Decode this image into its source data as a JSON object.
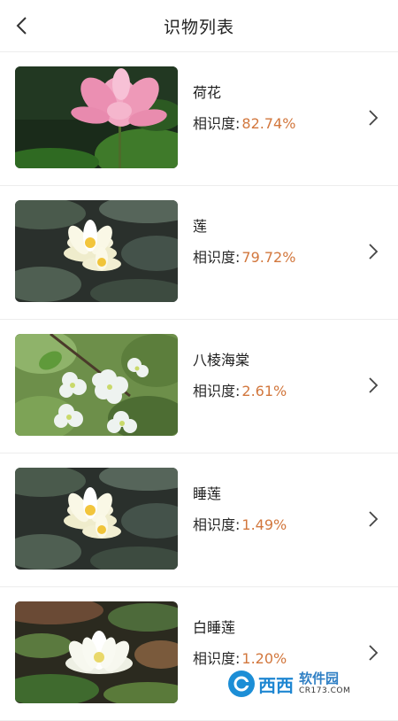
{
  "header": {
    "title": "识物列表",
    "back_icon": "chevron-left-icon"
  },
  "accent_color": "#d2773d",
  "results": [
    {
      "name": "荷花",
      "similarity_label": "相识度:",
      "similarity_value": "82.74%",
      "image": "pink-lotus-photo",
      "chevron_icon": "chevron-right-icon"
    },
    {
      "name": "莲",
      "similarity_label": "相识度:",
      "similarity_value": "79.72%",
      "image": "white-water-lily-photo",
      "chevron_icon": "chevron-right-icon"
    },
    {
      "name": "八棱海棠",
      "similarity_label": "相识度:",
      "similarity_value": "2.61%",
      "image": "white-crabapple-blossom-photo",
      "chevron_icon": "chevron-right-icon"
    },
    {
      "name": "睡莲",
      "similarity_label": "相识度:",
      "similarity_value": "1.49%",
      "image": "white-water-lily-photo",
      "chevron_icon": "chevron-right-icon"
    },
    {
      "name": "白睡莲",
      "similarity_label": "相识度:",
      "similarity_value": "1.20%",
      "image": "white-water-lily-dark-photo",
      "chevron_icon": "chevron-right-icon"
    }
  ],
  "watermark": {
    "brand": "西西",
    "name_cn": "软件园",
    "domain": "CR173.COM"
  }
}
